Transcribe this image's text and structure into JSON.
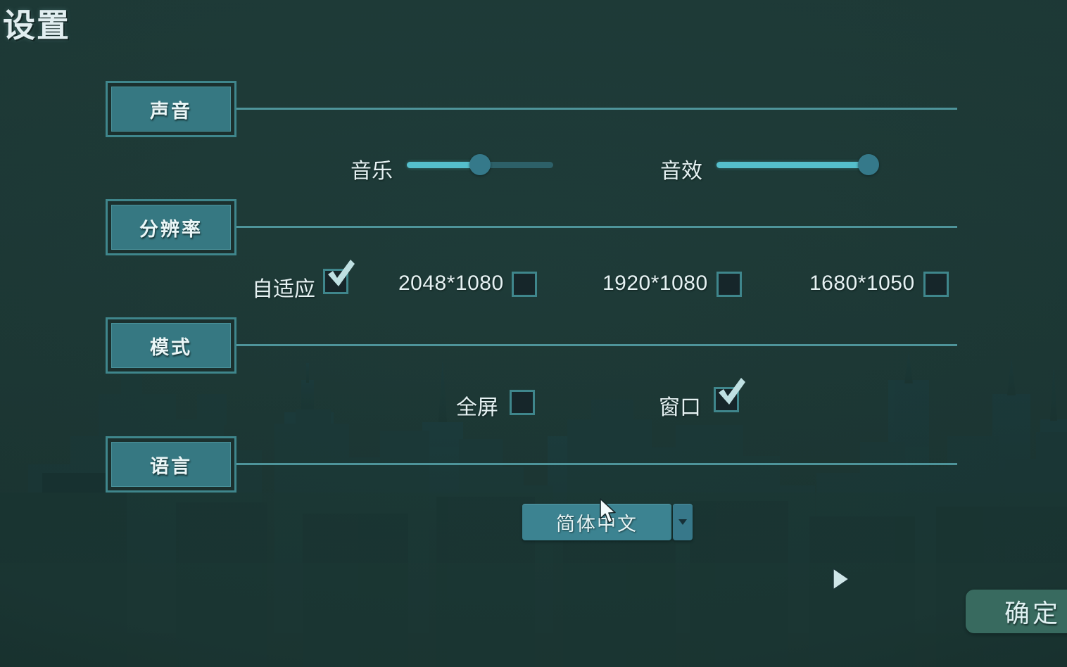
{
  "page": {
    "title": "设置",
    "background_color": "#1e3a37",
    "accent_color": "#3f868c",
    "slider_fill_color": "#55bfcc"
  },
  "sections": [
    {
      "key": "sound",
      "label": "声音"
    },
    {
      "key": "resolution",
      "label": "分辨率"
    },
    {
      "key": "mode",
      "label": "模式"
    },
    {
      "key": "language",
      "label": "语言"
    }
  ],
  "sound": {
    "music": {
      "label": "音乐",
      "value": 50,
      "min": 0,
      "max": 100
    },
    "sfx": {
      "label": "音效",
      "value": 100,
      "min": 0,
      "max": 100
    }
  },
  "resolution": {
    "options": [
      {
        "label": "自适应",
        "checked": true
      },
      {
        "label": "2048*1080",
        "checked": false
      },
      {
        "label": "1920*1080",
        "checked": false
      },
      {
        "label": "1680*1050",
        "checked": false
      }
    ]
  },
  "mode": {
    "options": [
      {
        "label": "全屏",
        "checked": false
      },
      {
        "label": "窗口",
        "checked": true
      }
    ]
  },
  "language": {
    "selected": "简体中文",
    "arrow_glyph": "▼"
  },
  "footer": {
    "confirm_label": "确定"
  }
}
